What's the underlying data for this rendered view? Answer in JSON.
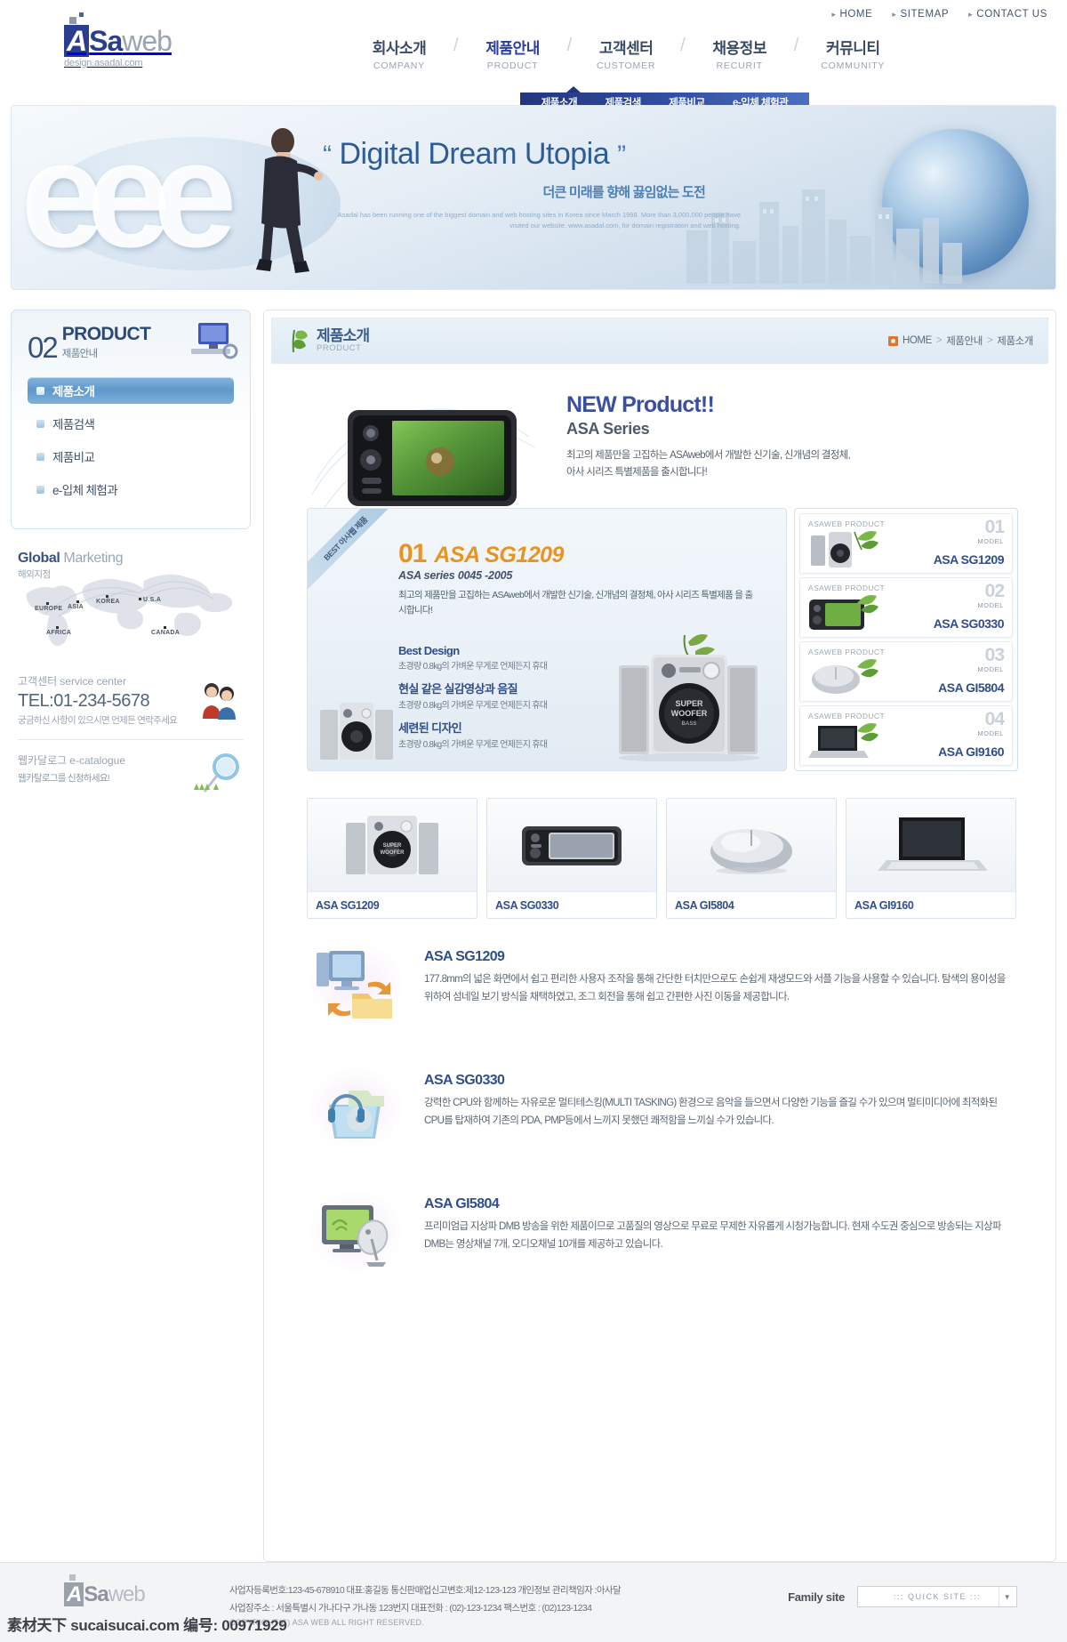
{
  "utility": {
    "links": [
      {
        "label": "HOME"
      },
      {
        "label": "SITEMAP"
      },
      {
        "label": "CONTACT US"
      }
    ]
  },
  "logo": {
    "a": "A",
    "sa": "Sa",
    "web": "web",
    "tagline": "design.asadal.com"
  },
  "gnb": {
    "items": [
      {
        "ko": "회사소개",
        "en": "COMPANY"
      },
      {
        "ko": "제품안내",
        "en": "PRODUCT"
      },
      {
        "ko": "고객센터",
        "en": "CUSTOMER"
      },
      {
        "ko": "채용정보",
        "en": "RECURIT"
      },
      {
        "ko": "커뮤니티",
        "en": "COMMUNITY"
      }
    ],
    "separator": "/"
  },
  "subnav": {
    "items": [
      {
        "label": "제품소개"
      },
      {
        "label": "제품검색"
      },
      {
        "label": "제품비교"
      },
      {
        "label": "e-입체 체험관"
      }
    ]
  },
  "banner": {
    "letters": "eee",
    "title_open_quote": "“",
    "title": "Digital Dream Utopia",
    "title_close_quote": "”",
    "subtitle": "더큰 미래를 향해 끓임없는 도전",
    "fine_print": "Asadal has been running one of the biggest domain and web hosting sites in Korea since March 1998. More than 3,000,000 people have visited our website. www.asadal.com, for domain registration and web hosting."
  },
  "sidebar": {
    "lnb": {
      "number": "02",
      "title": "PRODUCT",
      "subtitle": "제품안내",
      "items": [
        {
          "label": "제품소개",
          "active": true
        },
        {
          "label": "제품검색",
          "active": false
        },
        {
          "label": "제품비교",
          "active": false
        },
        {
          "label": "e-입체 체험과",
          "active": false
        }
      ]
    },
    "global": {
      "title_bold": "Global",
      "title_light": " Marketing",
      "subtitle": "해외지점",
      "labels": [
        "EUROPE",
        "ASIA",
        "KOREA",
        "U.S.A",
        "AFRICA",
        "CANADA"
      ]
    },
    "service": {
      "title": "고객센터",
      "title_en": "service center",
      "tel": "TEL:01-234-5678",
      "note": "궁금하신 사항이 있으시면 언제든 연락주세요"
    },
    "catalogue": {
      "title": "웹카달로그",
      "title_en": "e-catalogue",
      "note": "웹카탈로그를 신청하세요!"
    }
  },
  "page_head": {
    "title": "제품소개",
    "subtitle": "PRODUCT",
    "breadcrumb": [
      "HOME",
      "제품안내",
      "제품소개"
    ],
    "separator": ">"
  },
  "hero": {
    "title": "NEW Product!!",
    "subtitle": "ASA Series",
    "desc_line1": "최고의 제품만을 고집하는 ASAweb에서 개발한 신기술, 신개념의 결정체,",
    "desc_line2": "아사 시리즈 특별제품을 출시합니다!"
  },
  "best": {
    "ribbon": "BEST 아사웹 제품",
    "number": "01",
    "model": "ASA SG1209",
    "series": "ASA series 0045 -2005",
    "desc_line1": "최고의 제품만을 고집하는 ASAweb에서 개발한 신기술, 신개념의 결정체, 아사 시리즈 특별제품",
    "desc_line2": "을 출시합니다!",
    "features": [
      {
        "heading": "Best Design",
        "text": "초경량 0.8kg의 가벼운 무게로 언제든지 휴대"
      },
      {
        "heading": "현실 같은 실감영상과 음질",
        "text": "초경량 0.8kg의 가벼운 무게로 언제든지 휴대"
      },
      {
        "heading": "세련된 디자인",
        "text": "초경량 0.8kg의 가벼운 무게로 언제든지 휴대"
      }
    ],
    "speaker_badge_line1": "SUPER",
    "speaker_badge_line2": "WOOFER",
    "speaker_badge_line3": "BASS"
  },
  "product_side": {
    "eyebrow": "ASAWEB PRODUCT",
    "model_label": "MODEL",
    "cards": [
      {
        "num": "01",
        "model": "ASA SG1209",
        "kind": "speaker"
      },
      {
        "num": "02",
        "model": "ASA SG0330",
        "kind": "pmp"
      },
      {
        "num": "03",
        "model": "ASA GI5804",
        "kind": "mouse"
      },
      {
        "num": "04",
        "model": "ASA GI9160",
        "kind": "laptop"
      }
    ]
  },
  "thumbnails": [
    {
      "caption": "ASA SG1209",
      "kind": "speaker"
    },
    {
      "caption": "ASA SG0330",
      "kind": "pmp"
    },
    {
      "caption": "ASA GI5804",
      "kind": "mouse"
    },
    {
      "caption": "ASA GI9160",
      "kind": "laptop"
    }
  ],
  "feature_rows": [
    {
      "title": "ASA SG1209",
      "icon": "monitor-folder-sync-icon",
      "text": "177.8mm의 넓은 화면에서 쉽고 편리한 사용자 조작을 통해 간단한 터치만으로도 손쉽게 재생모드와 서플 기능을 사용할 수 있습니다. 탐색의 용이성을 위하여 섬네일 보기 방식을 채택하였고, 조그 회전을 통해 쉽고 간편한 사진 이동을 제공합니다."
    },
    {
      "title": "ASA SG0330",
      "icon": "headphone-media-folder-icon",
      "text": "강력한 CPU와 함께하는 자유로운 멀티테스킹(MULTI TASKING) 환경으로 음악을 들으면서 다양한 기능을 즐길 수가 있으며 멀티미디어에 최적화된 CPU를 탑재하여 기존의 PDA, PMP등에서 느끼지 못했던 쾌적함을 느끼실 수가 있습니다."
    },
    {
      "title": "ASA GI5804",
      "icon": "tv-satellite-dish-icon",
      "text": "프리미엄급 지상파 DMB 방송을 위한 제품이므로 고품질의 영상으로 무료로 무제한 자유롭게 시청가능합니다. 현재 수도권 중심으로 방송되는 지상파 DMB는 영상채널 7개, 오디오채널 10개를 제공하고 있습니다."
    }
  ],
  "footer": {
    "logo_a": "A",
    "logo_sa": "Sa",
    "logo_web": "web",
    "info_line1": "사업자등록번호:123-45-678910   대표:홍길동   통신판매업신고변호:제12-123-123   개인정보 관리책임자 :아사달",
    "info_line2": "사업장주소 : 서울특별시 가나다구 가나동 123번지   대표전화 : (02)-123-1234   팩스번호 : (02)123-1234",
    "copyright": "COPYRIGHT(C) ASA WEB  ALL RIGHT RESERVED.",
    "family_label": "Family site",
    "quick_site": "::: QUICK SITE :::",
    "quick_arrow": "▼"
  },
  "watermark": "素材天下 sucaisucai.com  编号: 00971929",
  "colors": {
    "brand_navy": "#2b3d8f",
    "accent_blue": "#2f4e8c",
    "accent_orange": "#e8941f",
    "lnb_active": "#5f98cb"
  }
}
